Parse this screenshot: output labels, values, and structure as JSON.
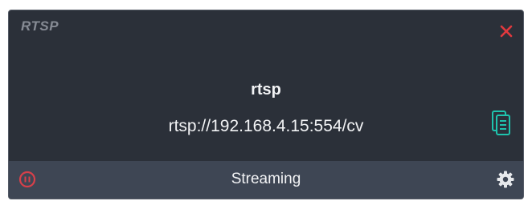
{
  "card": {
    "title": "RTSP",
    "close_icon": "close-icon",
    "stream_name": "rtsp",
    "stream_url": "rtsp://192.168.4.15:554/cv",
    "copy_icon": "copy-icon"
  },
  "footer": {
    "pause_icon": "pause-icon",
    "status": "Streaming",
    "settings_icon": "gear-icon"
  },
  "colors": {
    "card_background": "#2b3039",
    "footer_background": "#3e4654",
    "close_red": "#e0393e",
    "pause_red": "#d7404a",
    "copy_teal": "#1fc3ad",
    "title_gray": "#868b94",
    "text_white": "#f2f3f5"
  }
}
